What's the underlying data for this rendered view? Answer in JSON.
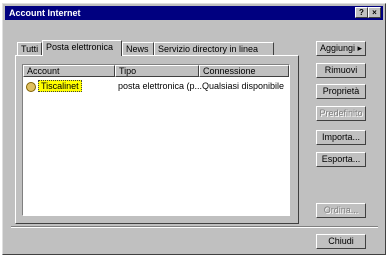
{
  "window": {
    "title": "Account Internet",
    "help_glyph": "?",
    "close_glyph": "×"
  },
  "tabs": [
    {
      "label": "Tutti"
    },
    {
      "label": "Posta elettronica"
    },
    {
      "label": "News"
    },
    {
      "label": "Servizio directory in linea"
    }
  ],
  "list": {
    "columns": [
      "Account",
      "Tipo",
      "Connessione"
    ],
    "rows": [
      {
        "account": "Tiscalinet",
        "tipo": "posta elettronica (p...",
        "connessione": "Qualsiasi disponibile"
      }
    ]
  },
  "buttons": {
    "add": "Aggiungi",
    "add_arrow": "▸",
    "remove": "Rimuovi",
    "properties": "Proprietà",
    "set_default": "Predefinito",
    "import": "Importa...",
    "export": "Esporta...",
    "order": "Ordina...",
    "close": "Chiudi"
  }
}
